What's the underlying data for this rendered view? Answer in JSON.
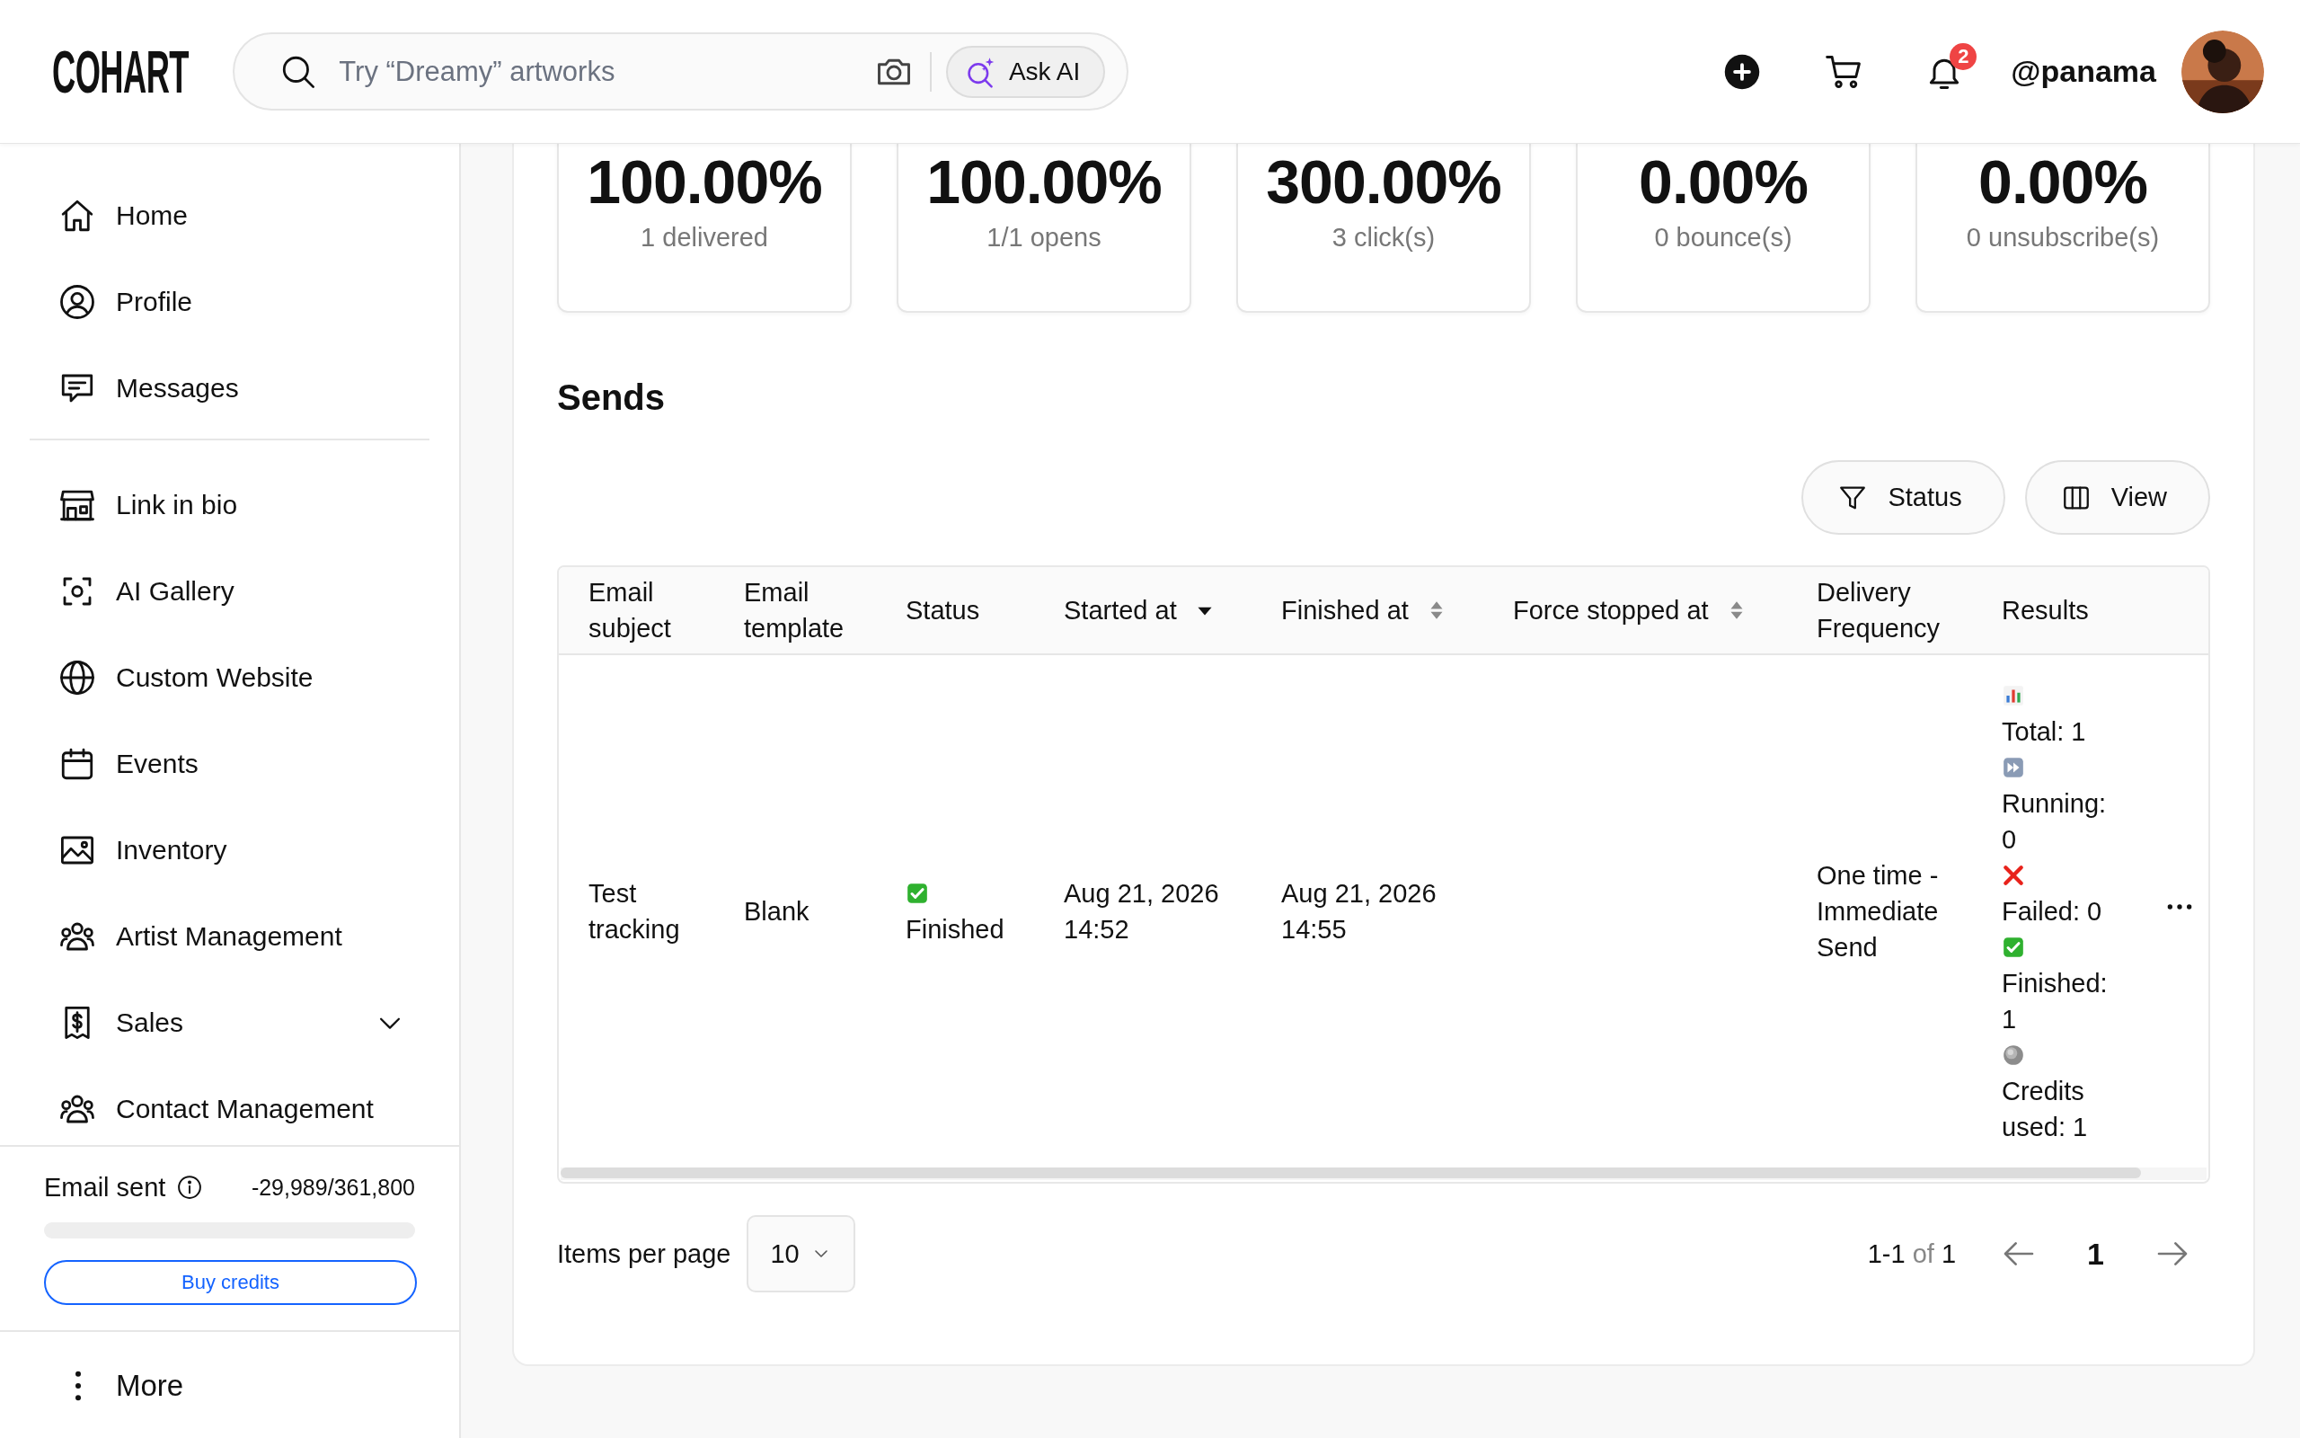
{
  "header": {
    "logo": "COHART",
    "search": {
      "placeholder": "Try “Dreamy” artworks"
    },
    "ask_ai": "Ask AI",
    "notifications": {
      "count": "2"
    },
    "username": "@panama"
  },
  "sidebar": {
    "sections": [
      {
        "items": [
          {
            "label": "Home"
          },
          {
            "label": "Profile"
          },
          {
            "label": "Messages"
          }
        ]
      },
      {
        "items": [
          {
            "label": "Link in bio"
          },
          {
            "label": "AI Gallery"
          },
          {
            "label": "Custom Website"
          },
          {
            "label": "Events"
          },
          {
            "label": "Inventory"
          },
          {
            "label": "Artist Management"
          },
          {
            "label": "Sales",
            "expanded": false
          },
          {
            "label": "Contact Management"
          }
        ]
      }
    ],
    "email_quota": {
      "label": "Email sent",
      "reading": "-29,989/361,800",
      "level": 0
    },
    "buy_button": "Buy credits",
    "more": "More"
  },
  "stats": [
    {
      "value": "100.00%",
      "label": "1 delivered"
    },
    {
      "value": "100.00%",
      "label": "1/1 opens"
    },
    {
      "value": "300.00%",
      "label": "3 click(s)"
    },
    {
      "value": "0.00%",
      "label": "0 bounce(s)"
    },
    {
      "value": "0.00%",
      "label": "0 unsubscribe(s)"
    }
  ],
  "sends": {
    "title": "Sends",
    "filters": [
      {
        "label": "Status"
      },
      {
        "label": "View"
      }
    ],
    "table": {
      "columns": [
        {
          "label": "Email subject",
          "sortable": false,
          "sorted": false
        },
        {
          "label": "Email template",
          "sortable": false,
          "sorted": false
        },
        {
          "label": "Status",
          "sortable": false,
          "sorted": false
        },
        {
          "label": "Started at",
          "sortable": true,
          "sorted": true
        },
        {
          "label": "Finished at",
          "sortable": true,
          "sorted": false
        },
        {
          "label": "Force stopped at",
          "sortable": true,
          "sorted": false
        },
        {
          "label": "Delivery Frequency",
          "sortable": false,
          "sorted": false
        },
        {
          "label": "Results",
          "sortable": false,
          "sorted": false
        }
      ],
      "rows": [
        {
          "email_subject": "Test tracking",
          "email_template": "Blank",
          "status": {
            "kind": "finished",
            "text": "Finished"
          },
          "started_at": "Aug 21, 2026 14:52",
          "finished_at": "Aug 21, 2026 14:55",
          "delivery_frequency": "One time - Immediate Send",
          "results": [
            {
              "kind": "total",
              "text": "Total: 1"
            },
            {
              "kind": "running",
              "text": "Running: 0"
            },
            {
              "kind": "failed",
              "text": "Failed: 0"
            },
            {
              "kind": "finished",
              "text": "Finished: 1"
            },
            {
              "kind": "credits",
              "text": "Credits used: 1"
            }
          ]
        }
      ]
    },
    "pagination": {
      "label": "Items per page",
      "page_size": "10",
      "range": "1-1",
      "of": "of",
      "total": "1",
      "pages": [
        {
          "label": "1",
          "selected": true
        }
      ]
    }
  }
}
